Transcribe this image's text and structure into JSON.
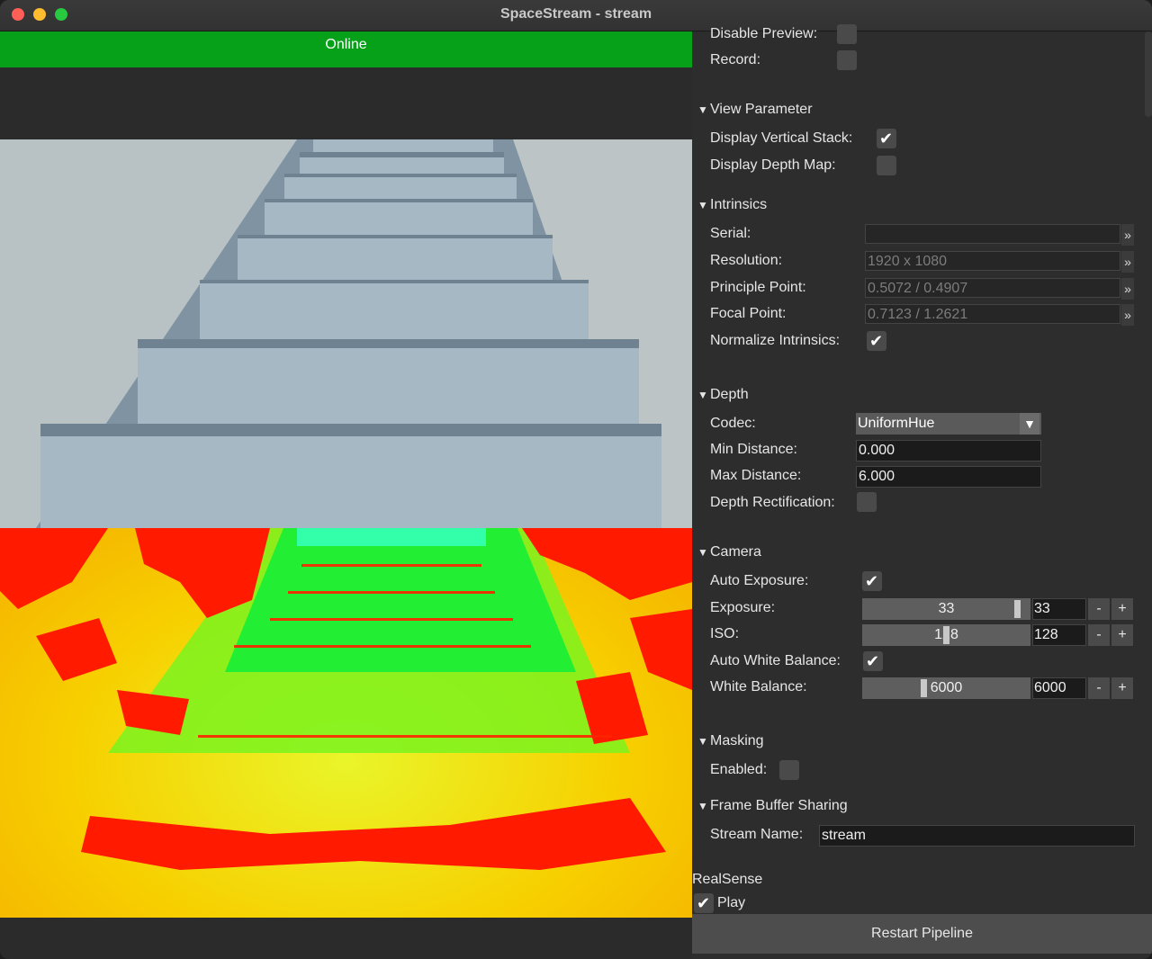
{
  "window": {
    "title": "SpaceStream - stream"
  },
  "status": {
    "label": "Online",
    "color": "#07a019"
  },
  "colors": {
    "panel_bg": "#2d2d2d",
    "online_green": "#07a019"
  },
  "settings": {
    "disable_preview": {
      "label": "Disable Preview:",
      "checked": false
    },
    "record": {
      "label": "Record:",
      "checked": false
    },
    "view_parameter": {
      "title": "View Parameter",
      "display_vertical_stack": {
        "label": "Display Vertical Stack:",
        "checked": true
      },
      "display_depth_map": {
        "label": "Display Depth Map:",
        "checked": false
      }
    },
    "intrinsics": {
      "title": "Intrinsics",
      "serial": {
        "label": "Serial:",
        "value": ""
      },
      "resolution": {
        "label": "Resolution:",
        "value": "1920 x 1080"
      },
      "principle_point": {
        "label": "Principle Point:",
        "value": "0.5072 / 0.4907"
      },
      "focal_point": {
        "label": "Focal Point:",
        "value": "0.7123 / 1.2621"
      },
      "normalize": {
        "label": "Normalize Intrinsics:",
        "checked": true
      },
      "more_glyph": "»"
    },
    "depth": {
      "title": "Depth",
      "codec": {
        "label": "Codec:",
        "value": "UniformHue"
      },
      "min_distance": {
        "label": "Min Distance:",
        "value": "0.000"
      },
      "max_distance": {
        "label": "Max Distance:",
        "value": "6.000"
      },
      "rectification": {
        "label": "Depth Rectification:",
        "checked": false
      }
    },
    "camera": {
      "title": "Camera",
      "auto_exposure": {
        "label": "Auto Exposure:",
        "checked": true
      },
      "exposure": {
        "label": "Exposure:",
        "slider_value": "33",
        "value": "33",
        "fraction": 0.94
      },
      "iso": {
        "label": "ISO:",
        "slider_value": "128",
        "value": "128",
        "fraction": 0.5
      },
      "auto_white_balance": {
        "label": "Auto White Balance:",
        "checked": true
      },
      "white_balance": {
        "label": "White Balance:",
        "slider_value": "6000",
        "value": "6000",
        "fraction": 0.36
      },
      "minus": "-",
      "plus": "+"
    },
    "masking": {
      "title": "Masking",
      "enabled": {
        "label": "Enabled:",
        "checked": false
      }
    },
    "frame_buffer_sharing": {
      "title": "Frame Buffer Sharing",
      "stream_name": {
        "label": "Stream Name:",
        "value": "stream"
      }
    }
  },
  "realsense": {
    "title": "RealSense",
    "play": {
      "label": "Play",
      "checked": true
    },
    "restart_label": "Restart Pipeline"
  }
}
